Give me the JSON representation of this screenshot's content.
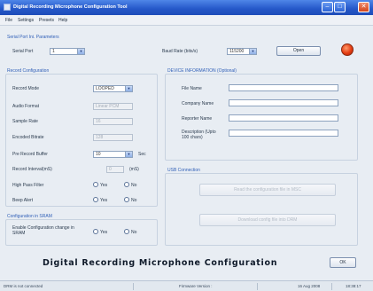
{
  "window": {
    "title": "Digital Recording Microphone Configuration Tool",
    "controls": {
      "minimize": "–",
      "maximize": "□",
      "close": "✕"
    }
  },
  "menu": [
    "File",
    "Settings",
    "Presets",
    "Help"
  ],
  "serial": {
    "group_title": "Serial Port Ini. Parameters",
    "port_label": "Serial Port",
    "port_value": "1",
    "baud_label": "Baud Rate (bits/s)",
    "baud_value": "115200",
    "open_label": "Open"
  },
  "record_config": {
    "group_title": "Record Configuration",
    "rows": [
      {
        "label": "Record Mode",
        "value": "LOOPED",
        "disabled": false,
        "kind": "select"
      },
      {
        "label": "Audio Format",
        "value": "Linear PCM",
        "disabled": true,
        "kind": "input"
      },
      {
        "label": "Sample Rate",
        "value": "16",
        "disabled": true,
        "kind": "input"
      },
      {
        "label": "Encoded Bitrate",
        "value": "128",
        "disabled": true,
        "kind": "input"
      },
      {
        "label": "Pre Record Buffer",
        "value": "10",
        "disabled": false,
        "kind": "select",
        "unit": "Sec"
      },
      {
        "label": "Record Interval(mS)",
        "value": "0",
        "disabled": true,
        "kind": "input",
        "unit": "(mS)"
      }
    ],
    "high_pass_label": "High Pass Filter",
    "beep_label": "Beep Alert",
    "yes_label": "Yes",
    "no_label": "No"
  },
  "config_sram": {
    "group_title": "Configuration in SRAM",
    "enable_label": "Enable Configuration change in SRAM",
    "yes_label": "Yes",
    "no_label": "No"
  },
  "device_info": {
    "group_title": "DEVICE INFORMATION (Optional)",
    "fields": [
      "File Name",
      "Company Name",
      "Reporter Name",
      "Description (Upto 100 chars)"
    ]
  },
  "usb": {
    "group_title": "USB Connection",
    "read_button": "Read the configuration file in MSC",
    "write_button": "Download config file into DRM"
  },
  "footer": {
    "app_title": "Digital Recording Microphone Configuration",
    "ok_label": "OK"
  },
  "status": {
    "left": "DRM is not connected",
    "middle": "Firmware Version :",
    "date": "16 Aug 2008",
    "time": "18:38:17"
  },
  "colors": {
    "titlebar": "#2457c8",
    "group_title": "#3160b8",
    "led": "#e43d13"
  }
}
